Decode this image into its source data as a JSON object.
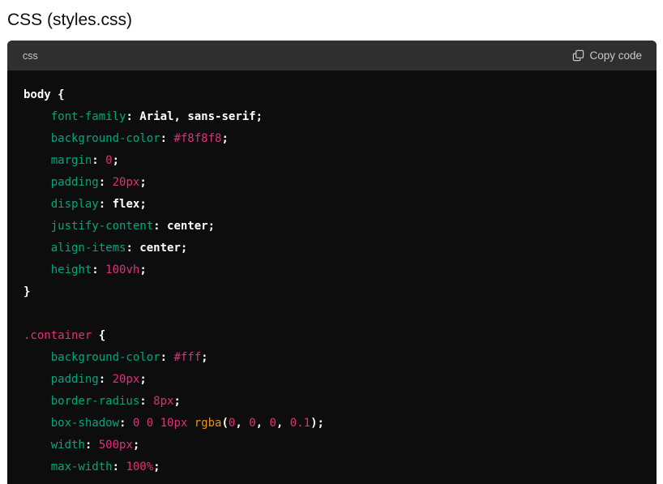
{
  "heading": "CSS (styles.css)",
  "code_block": {
    "language": "css",
    "copy_label": "Copy code",
    "copy_icon": "copy-icon",
    "lines": [
      [
        {
          "t": "body",
          "c": "sel"
        },
        {
          "t": " {",
          "c": "punc"
        }
      ],
      [
        {
          "t": "    ",
          "c": "punc"
        },
        {
          "t": "font-family",
          "c": "prop"
        },
        {
          "t": ": ",
          "c": "punc"
        },
        {
          "t": "Arial",
          "c": "kw"
        },
        {
          "t": ", ",
          "c": "punc"
        },
        {
          "t": "sans-serif",
          "c": "kw"
        },
        {
          "t": ";",
          "c": "punc"
        }
      ],
      [
        {
          "t": "    ",
          "c": "punc"
        },
        {
          "t": "background-color",
          "c": "prop"
        },
        {
          "t": ": ",
          "c": "punc"
        },
        {
          "t": "#f8f8f8",
          "c": "num"
        },
        {
          "t": ";",
          "c": "punc"
        }
      ],
      [
        {
          "t": "    ",
          "c": "punc"
        },
        {
          "t": "margin",
          "c": "prop"
        },
        {
          "t": ": ",
          "c": "punc"
        },
        {
          "t": "0",
          "c": "num"
        },
        {
          "t": ";",
          "c": "punc"
        }
      ],
      [
        {
          "t": "    ",
          "c": "punc"
        },
        {
          "t": "padding",
          "c": "prop"
        },
        {
          "t": ": ",
          "c": "punc"
        },
        {
          "t": "20px",
          "c": "num"
        },
        {
          "t": ";",
          "c": "punc"
        }
      ],
      [
        {
          "t": "    ",
          "c": "punc"
        },
        {
          "t": "display",
          "c": "prop"
        },
        {
          "t": ": ",
          "c": "punc"
        },
        {
          "t": "flex",
          "c": "kw"
        },
        {
          "t": ";",
          "c": "punc"
        }
      ],
      [
        {
          "t": "    ",
          "c": "punc"
        },
        {
          "t": "justify-content",
          "c": "prop"
        },
        {
          "t": ": ",
          "c": "punc"
        },
        {
          "t": "center",
          "c": "kw"
        },
        {
          "t": ";",
          "c": "punc"
        }
      ],
      [
        {
          "t": "    ",
          "c": "punc"
        },
        {
          "t": "align-items",
          "c": "prop"
        },
        {
          "t": ": ",
          "c": "punc"
        },
        {
          "t": "center",
          "c": "kw"
        },
        {
          "t": ";",
          "c": "punc"
        }
      ],
      [
        {
          "t": "    ",
          "c": "punc"
        },
        {
          "t": "height",
          "c": "prop"
        },
        {
          "t": ": ",
          "c": "punc"
        },
        {
          "t": "100vh",
          "c": "num"
        },
        {
          "t": ";",
          "c": "punc"
        }
      ],
      [
        {
          "t": "}",
          "c": "punc"
        }
      ],
      [
        {
          "t": "",
          "c": "punc"
        }
      ],
      [
        {
          "t": ".container",
          "c": "cls"
        },
        {
          "t": " {",
          "c": "punc"
        }
      ],
      [
        {
          "t": "    ",
          "c": "punc"
        },
        {
          "t": "background-color",
          "c": "prop"
        },
        {
          "t": ": ",
          "c": "punc"
        },
        {
          "t": "#fff",
          "c": "num"
        },
        {
          "t": ";",
          "c": "punc"
        }
      ],
      [
        {
          "t": "    ",
          "c": "punc"
        },
        {
          "t": "padding",
          "c": "prop"
        },
        {
          "t": ": ",
          "c": "punc"
        },
        {
          "t": "20px",
          "c": "num"
        },
        {
          "t": ";",
          "c": "punc"
        }
      ],
      [
        {
          "t": "    ",
          "c": "punc"
        },
        {
          "t": "border-radius",
          "c": "prop"
        },
        {
          "t": ": ",
          "c": "punc"
        },
        {
          "t": "8px",
          "c": "num"
        },
        {
          "t": ";",
          "c": "punc"
        }
      ],
      [
        {
          "t": "    ",
          "c": "punc"
        },
        {
          "t": "box-shadow",
          "c": "prop"
        },
        {
          "t": ": ",
          "c": "punc"
        },
        {
          "t": "0 0 10px ",
          "c": "num"
        },
        {
          "t": "rgba",
          "c": "fnname"
        },
        {
          "t": "(",
          "c": "punc"
        },
        {
          "t": "0",
          "c": "num"
        },
        {
          "t": ", ",
          "c": "punc"
        },
        {
          "t": "0",
          "c": "num"
        },
        {
          "t": ", ",
          "c": "punc"
        },
        {
          "t": "0",
          "c": "num"
        },
        {
          "t": ", ",
          "c": "punc"
        },
        {
          "t": "0.1",
          "c": "num"
        },
        {
          "t": ");",
          "c": "punc"
        }
      ],
      [
        {
          "t": "    ",
          "c": "punc"
        },
        {
          "t": "width",
          "c": "prop"
        },
        {
          "t": ": ",
          "c": "punc"
        },
        {
          "t": "500px",
          "c": "num"
        },
        {
          "t": ";",
          "c": "punc"
        }
      ],
      [
        {
          "t": "    ",
          "c": "punc"
        },
        {
          "t": "max-width",
          "c": "prop"
        },
        {
          "t": ": ",
          "c": "punc"
        },
        {
          "t": "100%",
          "c": "num"
        },
        {
          "t": ";",
          "c": "punc"
        }
      ]
    ]
  }
}
